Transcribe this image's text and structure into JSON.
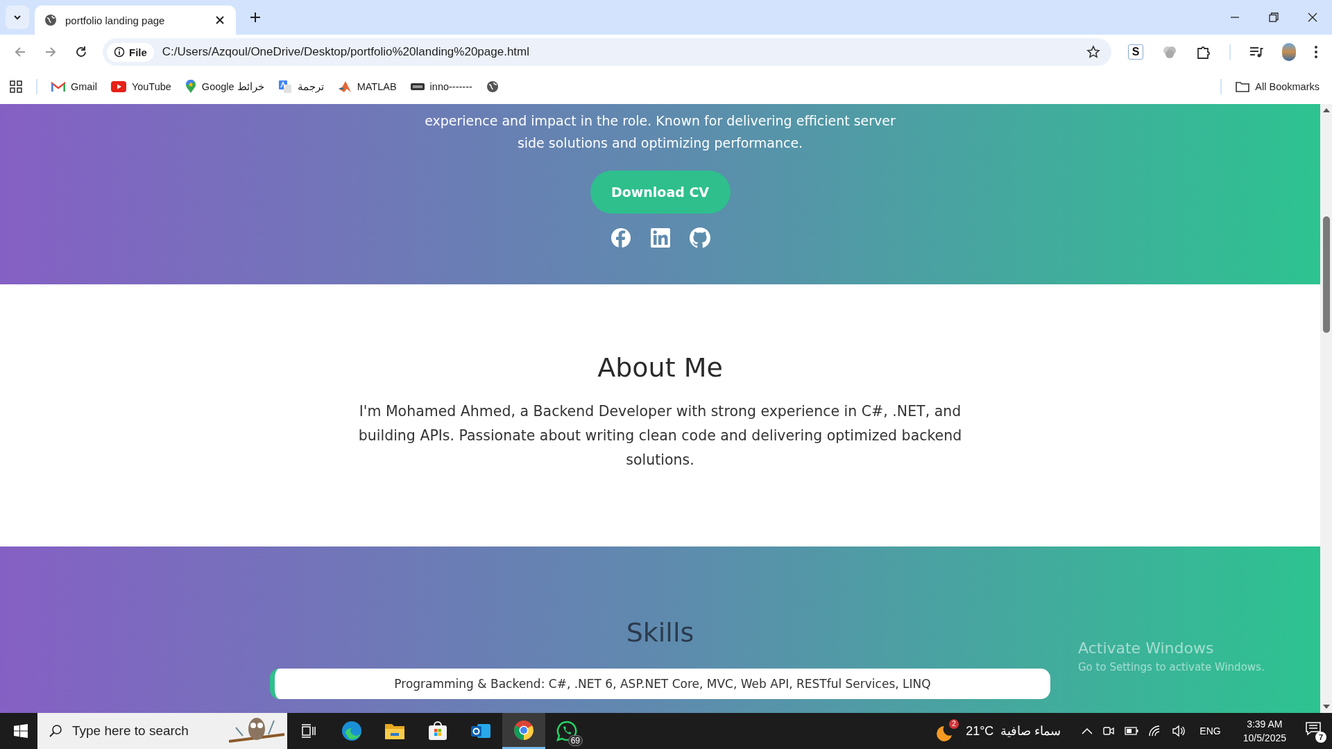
{
  "browser": {
    "tabs": [
      {
        "title": "portfolio landing page",
        "selected": true
      }
    ],
    "address": {
      "scheme": "File",
      "url": "C:/Users/Azqoul/OneDrive/Desktop/portfolio%20landing%20page.html"
    },
    "bookmarks": [
      {
        "kind": "gmail",
        "label": "Gmail"
      },
      {
        "kind": "youtube",
        "label": "YouTube"
      },
      {
        "kind": "maps",
        "label": "Google خرائط"
      },
      {
        "kind": "translate",
        "label": "ترجمة"
      },
      {
        "kind": "matlab",
        "label": "MATLAB"
      },
      {
        "kind": "inno",
        "label": "inno-------"
      },
      {
        "kind": "globe"
      }
    ],
    "extension_label": "S",
    "all_bookmarks": "All Bookmarks"
  },
  "hero": {
    "intro": "experience and impact in the role. Known for delivering efficient server side solutions and optimizing performance.",
    "cta": "Download CV"
  },
  "about": {
    "title": "About Me",
    "text": "I'm Mohamed Ahmed, a Backend Developer with strong experience in C#, .NET, and building APIs. Passionate about writing clean code and delivering optimized backend solutions."
  },
  "skills": {
    "title": "Skills",
    "items": [
      "Programming & Backend: C#, .NET 6, ASP.NET Core, MVC, Web API, RESTful Services, LINQ"
    ]
  },
  "os_notice": {
    "title": "Activate Windows",
    "text": "Go to Settings to activate Windows."
  },
  "taskbar": {
    "search_placeholder": "Type here to search",
    "apps": [
      {
        "kind": "taskview",
        "selected": false
      },
      {
        "kind": "edge",
        "selected": false
      },
      {
        "kind": "files",
        "selected": false
      },
      {
        "kind": "store",
        "selected": false
      },
      {
        "kind": "outlook",
        "selected": false
      },
      {
        "kind": "chrome",
        "selected": true
      },
      {
        "kind": "whatsapp",
        "selected": false,
        "badge": "69"
      }
    ],
    "weather": {
      "temp": "21°C",
      "condition": "سماء صافية",
      "badge": "2"
    },
    "language": "ENG",
    "time": "3:39 AM",
    "date": "10/5/2025",
    "notifications": "7"
  }
}
